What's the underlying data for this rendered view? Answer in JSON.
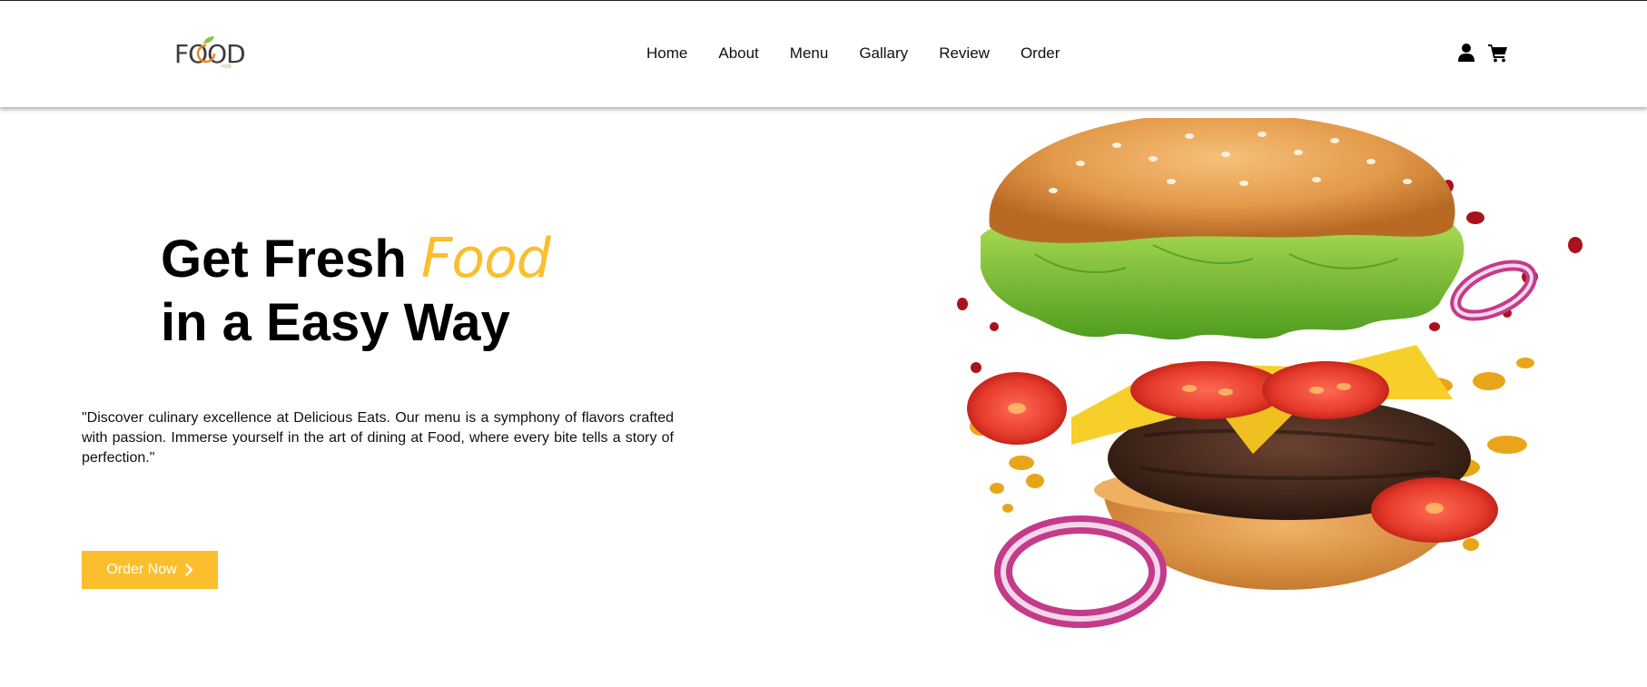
{
  "brand": {
    "logo_text": "FOOD",
    "logo_sub": "HUB"
  },
  "nav": {
    "items": [
      "Home",
      "About",
      "Menu",
      "Gallary",
      "Review",
      "Order"
    ]
  },
  "header_icons": [
    "user-icon",
    "cart-icon"
  ],
  "hero": {
    "title_part1": "Get Fresh",
    "title_accent": "Food",
    "title_line2": "in a Easy Way",
    "description": "\"Discover culinary excellence at Delicious Eats. Our menu is a symphony of flavors crafted with passion. Immerse yourself in the art of dining at Food, where every bite tells a story of perfection.\"",
    "button_label": "Order Now",
    "button_icon": "chevron-right-icon",
    "image_alt": "burger-image"
  },
  "colors": {
    "accent": "#fbbf2d",
    "logo_leaf": "#8cc63f",
    "logo_orange": "#f58220",
    "text": "#000000"
  }
}
